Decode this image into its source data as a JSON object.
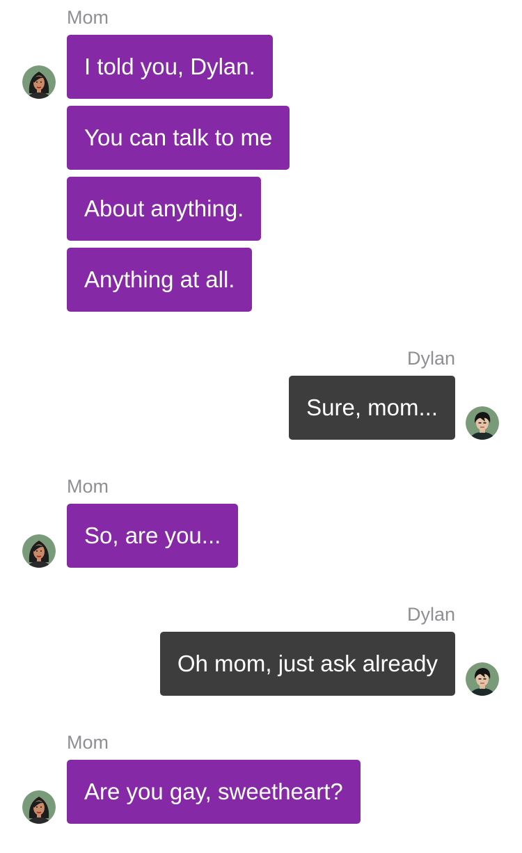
{
  "chat": {
    "groups": [
      {
        "sender": "Mom",
        "messages": [
          "I told you, Dylan.",
          "You can talk to me",
          "About anything.",
          "Anything at all."
        ]
      },
      {
        "sender": "Dylan",
        "messages": [
          "Sure, mom..."
        ]
      },
      {
        "sender": "Mom",
        "messages": [
          "So, are you..."
        ]
      },
      {
        "sender": "Dylan",
        "messages": [
          "Oh mom, just ask already"
        ]
      },
      {
        "sender": "Mom",
        "messages": [
          "Are you gay, sweetheart?"
        ]
      }
    ]
  },
  "avatars": {
    "mom": "mom-avatar-icon",
    "dylan": "dylan-avatar-icon"
  },
  "colors": {
    "mom_bubble": "#8629a6",
    "dylan_bubble": "#3d3d3d",
    "sender_name": "#8e8e93",
    "bubble_text": "#ffffff",
    "background": "#ffffff"
  }
}
